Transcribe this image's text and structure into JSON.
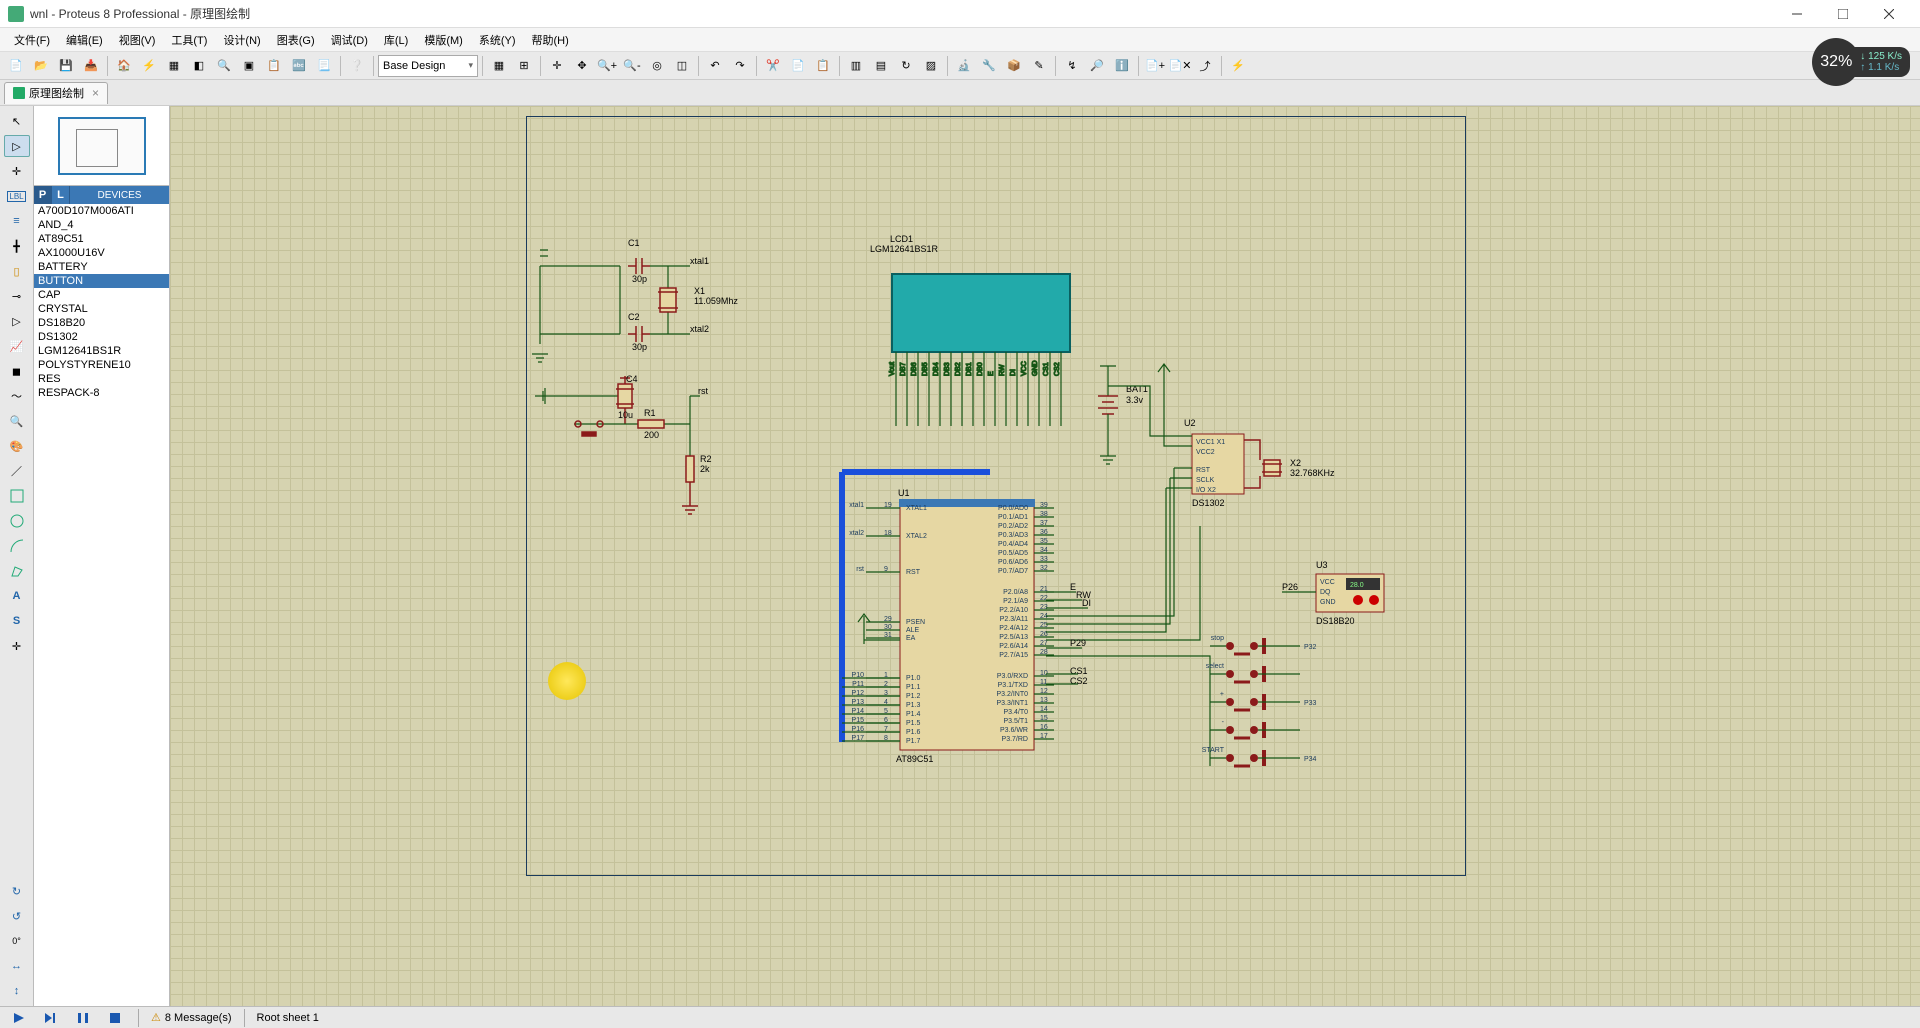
{
  "window": {
    "title": "wnl - Proteus 8 Professional - 原理图绘制"
  },
  "menubar": [
    "文件(F)",
    "编辑(E)",
    "视图(V)",
    "工具(T)",
    "设计(N)",
    "图表(G)",
    "调试(D)",
    "库(L)",
    "模版(M)",
    "系统(Y)",
    "帮助(H)"
  ],
  "toolbar": {
    "design_combo": "Base Design"
  },
  "tabs": {
    "main_tab": "原理图绘制"
  },
  "devices": {
    "header_p": "P",
    "header_l": "L",
    "header_label": "DEVICES",
    "items": [
      {
        "label": "A700D107M006ATI",
        "selected": false
      },
      {
        "label": "AND_4",
        "selected": false
      },
      {
        "label": "AT89C51",
        "selected": false
      },
      {
        "label": "AX1000U16V",
        "selected": false
      },
      {
        "label": "BATTERY",
        "selected": false
      },
      {
        "label": "BUTTON",
        "selected": true
      },
      {
        "label": "CAP",
        "selected": false
      },
      {
        "label": "CRYSTAL",
        "selected": false
      },
      {
        "label": "DS18B20",
        "selected": false
      },
      {
        "label": "DS1302",
        "selected": false
      },
      {
        "label": "LGM12641BS1R",
        "selected": false
      },
      {
        "label": "POLYSTYRENE10",
        "selected": false
      },
      {
        "label": "RES",
        "selected": false
      },
      {
        "label": "RESPACK-8",
        "selected": false
      }
    ]
  },
  "schematic": {
    "components": {
      "C1": {
        "ref": "C1",
        "value": "30p"
      },
      "C2": {
        "ref": "C2",
        "value": "30p"
      },
      "X1": {
        "ref": "X1",
        "value": "11.059Mhz"
      },
      "C4": {
        "ref": "C4",
        "value": "10u"
      },
      "R1": {
        "ref": "R1",
        "value": "200"
      },
      "R2": {
        "ref": "R2",
        "value": "2k"
      },
      "LCD1": {
        "ref": "LCD1",
        "part": "LGM12641BS1R"
      },
      "BAT1": {
        "ref": "BAT1",
        "value": "3.3v"
      },
      "U1": {
        "ref": "U1",
        "part": "AT89C51"
      },
      "U2": {
        "ref": "U2",
        "part": "DS1302",
        "pins": [
          "VCC1  X1",
          "VCC2",
          "RST",
          "SCLK",
          "I/O      X2"
        ]
      },
      "X2": {
        "ref": "X2",
        "value": "32.768KHz"
      },
      "U3": {
        "ref": "U3",
        "part": "DS18B20",
        "pins": [
          "VCC",
          "DQ",
          "GND"
        ],
        "reading": "28.0"
      }
    },
    "u1_left_pins": [
      {
        "num": "19",
        "name": "XTAL1",
        "net": "xtal1"
      },
      {
        "num": "18",
        "name": "XTAL2",
        "net": "xtal2"
      },
      {
        "num": "9",
        "name": "RST",
        "net": "rst"
      },
      {
        "num": "29",
        "name": "PSEN"
      },
      {
        "num": "30",
        "name": "ALE"
      },
      {
        "num": "31",
        "name": "EA"
      },
      {
        "num": "1",
        "name": "P1.0",
        "net": "P10"
      },
      {
        "num": "2",
        "name": "P1.1",
        "net": "P11"
      },
      {
        "num": "3",
        "name": "P1.2",
        "net": "P12"
      },
      {
        "num": "4",
        "name": "P1.3",
        "net": "P13"
      },
      {
        "num": "5",
        "name": "P1.4",
        "net": "P14"
      },
      {
        "num": "6",
        "name": "P1.5",
        "net": "P15"
      },
      {
        "num": "7",
        "name": "P1.6",
        "net": "P16"
      },
      {
        "num": "8",
        "name": "P1.7",
        "net": "P17"
      }
    ],
    "u1_right_pins": [
      {
        "num": "39",
        "name": "P0.0/AD0"
      },
      {
        "num": "38",
        "name": "P0.1/AD1"
      },
      {
        "num": "37",
        "name": "P0.2/AD2"
      },
      {
        "num": "36",
        "name": "P0.3/AD3"
      },
      {
        "num": "35",
        "name": "P0.4/AD4"
      },
      {
        "num": "34",
        "name": "P0.5/AD5"
      },
      {
        "num": "33",
        "name": "P0.6/AD6"
      },
      {
        "num": "32",
        "name": "P0.7/AD7"
      },
      {
        "num": "21",
        "name": "P2.0/A8"
      },
      {
        "num": "22",
        "name": "P2.1/A9"
      },
      {
        "num": "23",
        "name": "P2.2/A10"
      },
      {
        "num": "24",
        "name": "P2.3/A11"
      },
      {
        "num": "25",
        "name": "P2.4/A12"
      },
      {
        "num": "26",
        "name": "P2.5/A13"
      },
      {
        "num": "27",
        "name": "P2.6/A14"
      },
      {
        "num": "28",
        "name": "P2.7/A15"
      },
      {
        "num": "10",
        "name": "P3.0/RXD"
      },
      {
        "num": "11",
        "name": "P3.1/TXD"
      },
      {
        "num": "12",
        "name": "P3.2/INT0"
      },
      {
        "num": "13",
        "name": "P3.3/INT1"
      },
      {
        "num": "14",
        "name": "P3.4/T0"
      },
      {
        "num": "15",
        "name": "P3.5/T1"
      },
      {
        "num": "16",
        "name": "P3.6/WR"
      },
      {
        "num": "17",
        "name": "P3.7/RD"
      }
    ],
    "lcd_pins": [
      "Vout",
      "DB7",
      "DB6",
      "DB5",
      "DB4",
      "DB3",
      "DB2",
      "DB1",
      "DB0",
      "E",
      "RW",
      "DI",
      "VCC",
      "GND",
      "CS1",
      "CS2"
    ],
    "nets": {
      "xtal1": "xtal1",
      "xtal2": "xtal2",
      "rst": "rst",
      "E": "E",
      "RW": "RW",
      "DI": "DI",
      "CS1": "CS1",
      "CS2": "CS2",
      "P29": "P29",
      "P26": "P26",
      "stop": "stop",
      "select": "select",
      "plus": "+",
      "minus": "-",
      "START": "START",
      "P32": "P32",
      "P33": "P33",
      "P34": "P34"
    }
  },
  "statusbar": {
    "messages": "8 Message(s)",
    "sheet": "Root sheet 1"
  },
  "net_badge": {
    "percent": "32%",
    "down": "↓ 125 K/s",
    "up": "↑ 1.1 K/s"
  }
}
